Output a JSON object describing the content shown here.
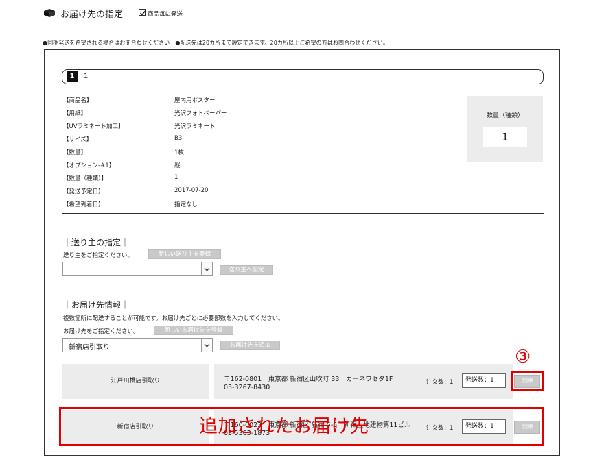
{
  "header": {
    "title": "お届け先の指定",
    "ship_per_item_label": "商品毎に発送",
    "ship_per_item_checked": true
  },
  "notice": "●同梱発送を希望される場合はお問合わせください　●配送先は20カ所まで設定できます。20カ所以上ご希望の方はお問合わせください。",
  "pager": {
    "current": "1",
    "next": "1"
  },
  "specs": [
    {
      "label": "【商品名】",
      "value": "屋内用ポスター"
    },
    {
      "label": "【用紙】",
      "value": "光沢フォトペーパー"
    },
    {
      "label": "【UVラミネート加工】",
      "value": "光沢ラミネート"
    },
    {
      "label": "【サイズ】",
      "value": "B3"
    },
    {
      "label": "【数量】",
      "value": "1枚"
    },
    {
      "label": "【オプション-#1】",
      "value": "縦"
    },
    {
      "label": "【数量（種類）】",
      "value": "1"
    },
    {
      "label": "【発送予定日】",
      "value": "2017-07-20"
    },
    {
      "label": "【希望到着日】",
      "value": "指定なし"
    }
  ],
  "qty_box": {
    "label": "数量（種類）",
    "value": "1"
  },
  "sender": {
    "title": "｜送り主の指定｜",
    "desc": "送り主をご指定ください。",
    "register_button": "新しい送り主を登録",
    "select_value": "",
    "set_button": "送り主へ設定"
  },
  "delivery": {
    "title": "｜お届け先情報｜",
    "desc1": "複数箇所に配送することが可能です。お届け先ごとに必要部数を入力してください。",
    "desc2": "お届け先をご指定ください。",
    "register_button": "新しいお届け先を登録",
    "select_value": "新宿店引取り",
    "add_button": "お届け先を追加"
  },
  "destinations": [
    {
      "name": "江戸川橋店引取り",
      "address": "〒162-0801　東京都 新宿区山吹町 33　カーネワセダ1F",
      "phone": "03-3267-8430",
      "order_label": "注文数：1",
      "send_qty": "発送数：1",
      "delete_label": "削除"
    },
    {
      "name": "新宿店引取り",
      "address": "〒160-0023　東京都 新宿区 新宿 5-5　新宿土地建物第11ビル",
      "phone": "03-5363-1873",
      "order_label": "注文数：1",
      "send_qty": "発送数：1",
      "delete_label": "削除"
    }
  ],
  "annotations": {
    "step_marker": "③",
    "added_note": "追加されたお届け先",
    "color": "#e00000"
  }
}
